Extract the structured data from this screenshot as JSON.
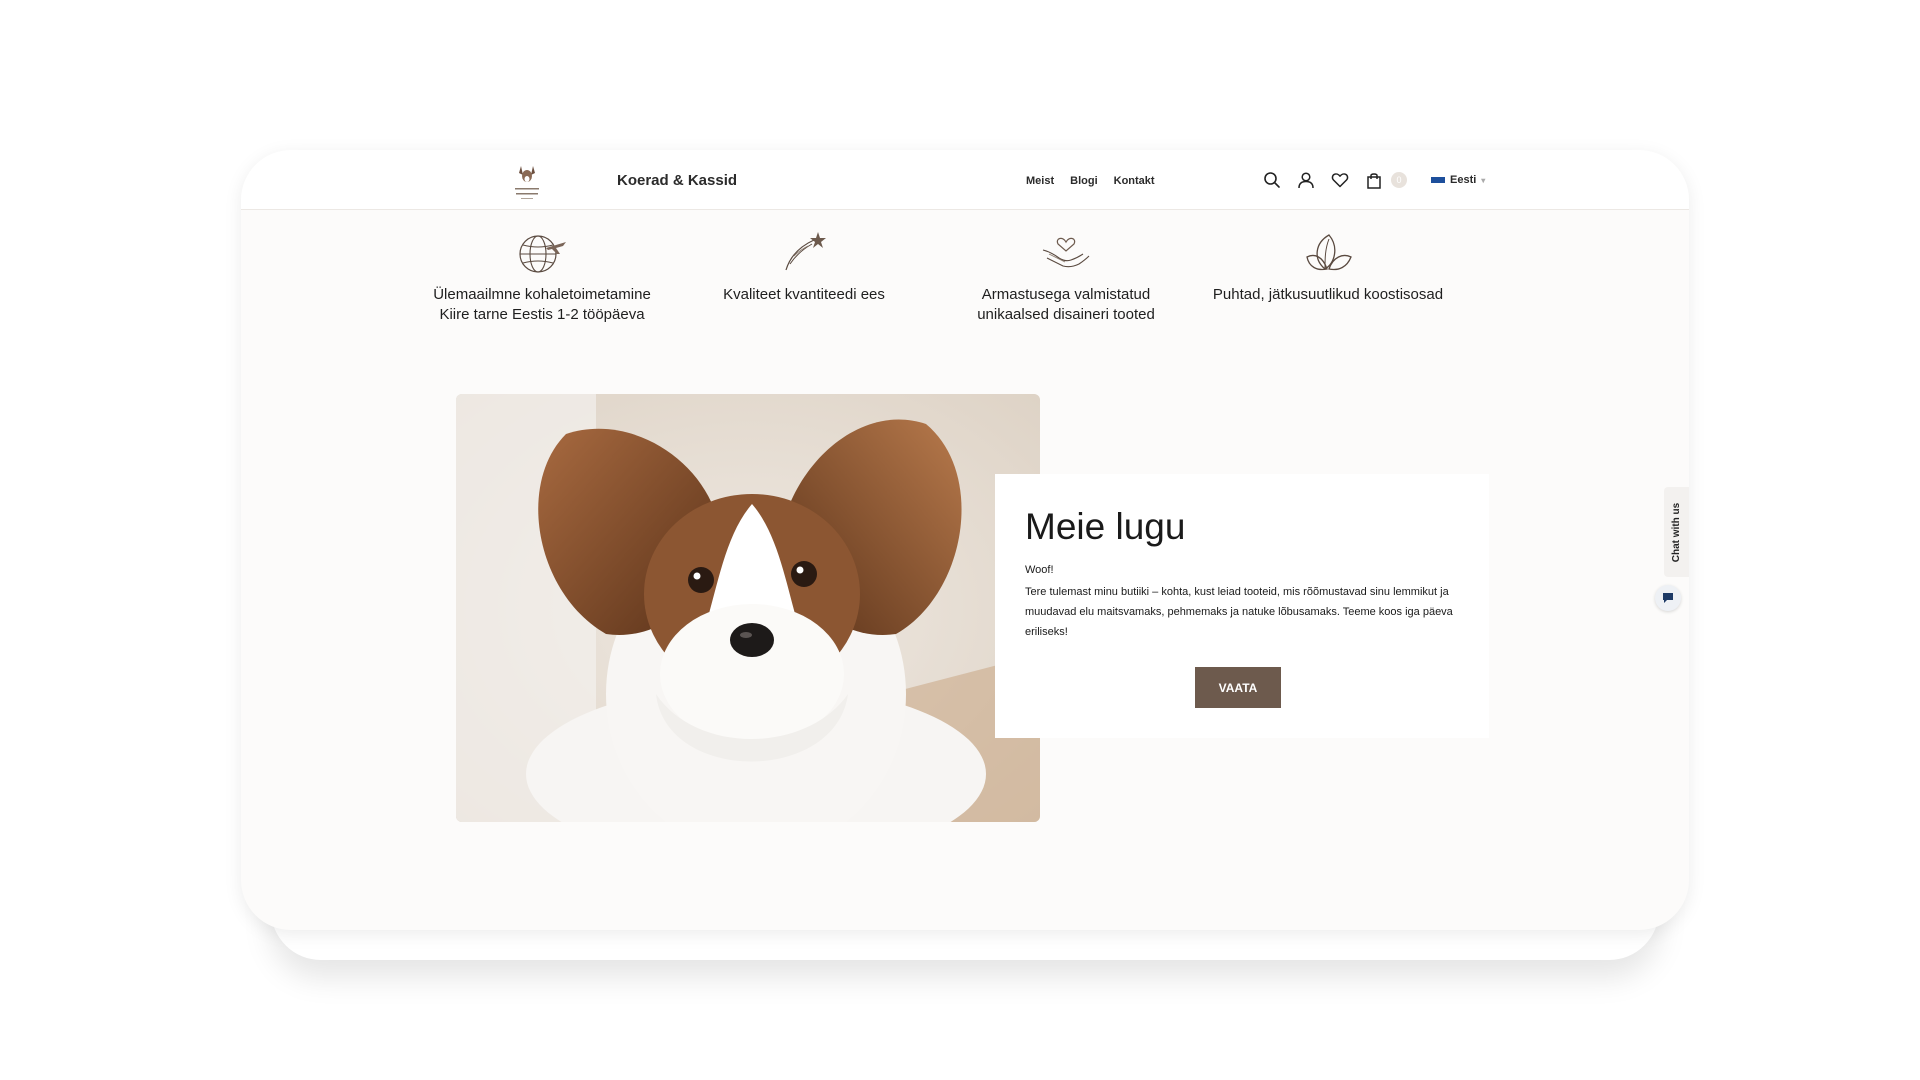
{
  "header": {
    "site_name": "Koerad & Kassid",
    "nav": [
      {
        "label": "Meist"
      },
      {
        "label": "Blogi"
      },
      {
        "label": "Kontakt"
      }
    ],
    "icons": [
      "search-icon",
      "account-icon",
      "wishlist-icon",
      "cart-icon"
    ],
    "cart_count": "0",
    "language": "Eesti"
  },
  "features": [
    {
      "icon": "globe-plane-icon",
      "lines": [
        "Ülemaailmne kohaletoimetamine",
        "Kiire tarne Eestis 1-2 tööpäeva"
      ]
    },
    {
      "icon": "shooting-star-icon",
      "lines": [
        "Kvaliteet kvantiteedi ees",
        ""
      ]
    },
    {
      "icon": "hands-heart-icon",
      "lines": [
        "Armastusega valmistatud",
        "unikaalsed disaineri tooted"
      ]
    },
    {
      "icon": "leaf-icon",
      "lines": [
        "Puhtad, jätkusuutlikud koostisosad",
        ""
      ]
    }
  ],
  "story": {
    "title": "Meie lugu",
    "greeting": "Woof!",
    "body": "Tere tulemast minu butiiki – kohta, kust leiad tooteid, mis rõõmustavad sinu lemmikut ja muudavad elu maitsvamaks, pehmemaks ja natuke lõbusamaks. Teeme koos iga päeva eriliseks!",
    "button": "VAATA"
  },
  "chat": {
    "label": "Chat with us"
  },
  "colors": {
    "accent": "#6d5a4d",
    "page_bg": "#fcfbfa",
    "flag": "#1d4f9c"
  }
}
